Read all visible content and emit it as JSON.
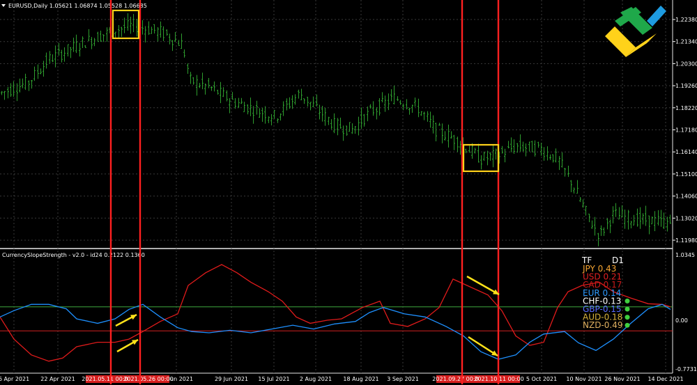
{
  "main_chart": {
    "title": "EURUSD,Daily",
    "ohlc_readout": "1.05621 1.06874 1.05528 1.06685",
    "y_ticks": [
      "1.22380",
      "1.21340",
      "1.20300",
      "1.19260",
      "1.18220",
      "1.17180",
      "1.16140",
      "1.15100",
      "1.14060",
      "1.13020",
      "1.11980"
    ],
    "ylim": [
      1.1198,
      1.2238
    ],
    "candle_color": "#2e9e2e"
  },
  "indicator": {
    "title": "CurrencySlopeStrength - v2.0 - id24 0.2122 0.1360",
    "y_ticks": {
      "top": "1.0345",
      "zero": "0.00",
      "bottom": "-0.7731"
    },
    "level_lines": [
      0.21,
      -0.17
    ],
    "legend_header": {
      "tf": "TF",
      "period": "D1"
    },
    "legend": [
      {
        "label": "JPY 0.43",
        "color": "#f4a331",
        "dot": false
      },
      {
        "label": "USD 0.21",
        "color": "#e02020",
        "dot": false
      },
      {
        "label": "CAD 0.17",
        "color": "#c81a1a",
        "dot": false
      },
      {
        "label": "EUR 0.14",
        "color": "#2e9bff",
        "dot": false
      },
      {
        "label": "CHF-0.13",
        "color": "#ffffff",
        "dot": true
      },
      {
        "label": "GBP-0.15",
        "color": "#5a6cff",
        "dot": true
      },
      {
        "label": "AUD-0.18",
        "color": "#d8b23a",
        "dot": true
      },
      {
        "label": "NZD-0.49",
        "color": "#e0b060",
        "dot": true
      }
    ]
  },
  "x_ticks": [
    "6 Apr 2021",
    "22 Apr 2021",
    "11 Jun 2021",
    "29 Jun 2021",
    "15 Jul 2021",
    "2 Aug 2021",
    "18 Aug 2021",
    "3 Sep 2021",
    "5 Oct 2021",
    "10 Nov 2021",
    "26 Nov 2021",
    "14 Dec 2021"
  ],
  "x_highlight_labels": [
    "2021.05.11 00:00",
    "2021.05.26 00:00",
    "2021.09.27 00:00",
    "2021.10.11 00:00"
  ],
  "colors": {
    "grid": "#3a3a3a",
    "eur_line": "#1e90ff",
    "usd_line": "#e01b1b",
    "marker": "#ff2020",
    "box": "#ffd21a",
    "arrow": "#ffe21a",
    "level_green": "#3fa83f",
    "level_red": "#d02020"
  },
  "chart_data": {
    "type": "line",
    "title": "EURUSD,Daily",
    "xlabel": "",
    "ylabel": "",
    "ylim": [
      1.1198,
      1.2238
    ],
    "series": [
      {
        "name": "EURUSD",
        "x": [
          "6 Apr 2021",
          "22 Apr 2021",
          "11 Jun 2021",
          "29 Jun 2021",
          "15 Jul 2021",
          "2 Aug 2021",
          "18 Aug 2021",
          "3 Sep 2021",
          "5 Oct 2021",
          "10 Nov 2021",
          "26 Nov 2021",
          "14 Dec 2021"
        ],
        "values": [
          1.188,
          1.202,
          1.218,
          1.192,
          1.18,
          1.188,
          1.171,
          1.187,
          1.16,
          1.146,
          1.126,
          1.129
        ]
      },
      {
        "name": "EUR",
        "values": [
          0.02,
          0.12,
          0.12,
          -0.08,
          -0.1,
          -0.08,
          -0.02,
          0.1,
          -0.55,
          -0.22,
          -0.18,
          0.14
        ]
      },
      {
        "name": "USD",
        "values": [
          -0.06,
          -0.55,
          0.0,
          0.7,
          0.62,
          0.02,
          -0.12,
          0.04,
          0.32,
          -0.4,
          0.4,
          0.21
        ]
      }
    ],
    "indicator_ylim": [
      -0.7731,
      1.0345
    ]
  }
}
